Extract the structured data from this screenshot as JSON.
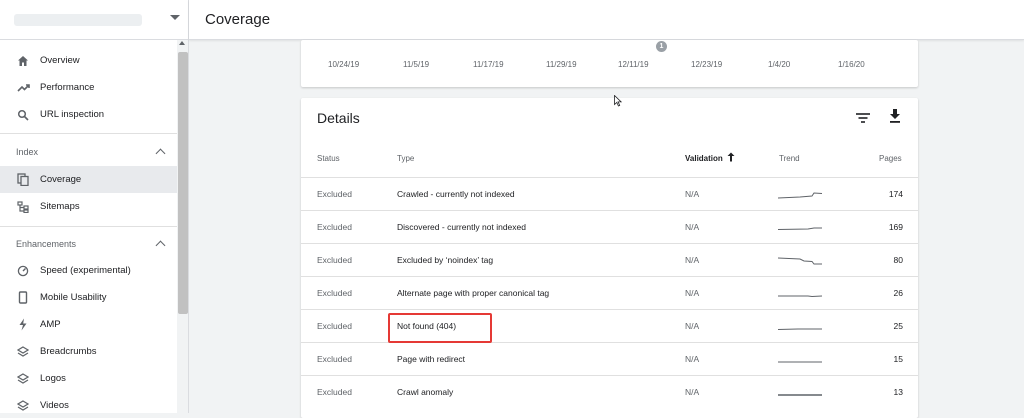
{
  "header": {
    "title": "Coverage"
  },
  "sidebar": {
    "items_top": [
      {
        "label": "Overview",
        "icon": "home-icon"
      },
      {
        "label": "Performance",
        "icon": "trending-up-icon"
      },
      {
        "label": "URL inspection",
        "icon": "search-icon"
      }
    ],
    "section_index": {
      "label": "Index"
    },
    "items_index": [
      {
        "label": "Coverage",
        "icon": "file-copy-icon",
        "active": true
      },
      {
        "label": "Sitemaps",
        "icon": "sitemap-icon"
      }
    ],
    "section_enh": {
      "label": "Enhancements"
    },
    "items_enh": [
      {
        "label": "Speed (experimental)",
        "icon": "gauge-icon"
      },
      {
        "label": "Mobile Usability",
        "icon": "phone-icon"
      },
      {
        "label": "AMP",
        "icon": "bolt-icon"
      },
      {
        "label": "Breadcrumbs",
        "icon": "layers-icon"
      },
      {
        "label": "Logos",
        "icon": "layers-icon"
      },
      {
        "label": "Videos",
        "icon": "layers-icon"
      }
    ]
  },
  "chart": {
    "x_ticks": [
      "10/24/19",
      "11/5/19",
      "11/17/19",
      "11/29/19",
      "12/11/19",
      "12/23/19",
      "1/4/20",
      "1/16/20"
    ],
    "annotation": "1"
  },
  "details": {
    "title": "Details",
    "columns": {
      "status": "Status",
      "type": "Type",
      "validation": "Validation",
      "trend": "Trend",
      "pages": "Pages"
    },
    "rows": [
      {
        "status": "Excluded",
        "type": "Crawled - currently not indexed",
        "validation": "N/A",
        "pages": "174"
      },
      {
        "status": "Excluded",
        "type": "Discovered - currently not indexed",
        "validation": "N/A",
        "pages": "169"
      },
      {
        "status": "Excluded",
        "type": "Excluded by ‘noindex’ tag",
        "validation": "N/A",
        "pages": "80"
      },
      {
        "status": "Excluded",
        "type": "Alternate page with proper canonical tag",
        "validation": "N/A",
        "pages": "26"
      },
      {
        "status": "Excluded",
        "type": "Not found (404)",
        "validation": "N/A",
        "pages": "25"
      },
      {
        "status": "Excluded",
        "type": "Page with redirect",
        "validation": "N/A",
        "pages": "15"
      },
      {
        "status": "Excluded",
        "type": "Crawl anomaly",
        "validation": "N/A",
        "pages": "13"
      }
    ]
  },
  "colors": {
    "highlight": "#e53935",
    "active_nav": "#e8eaed"
  }
}
